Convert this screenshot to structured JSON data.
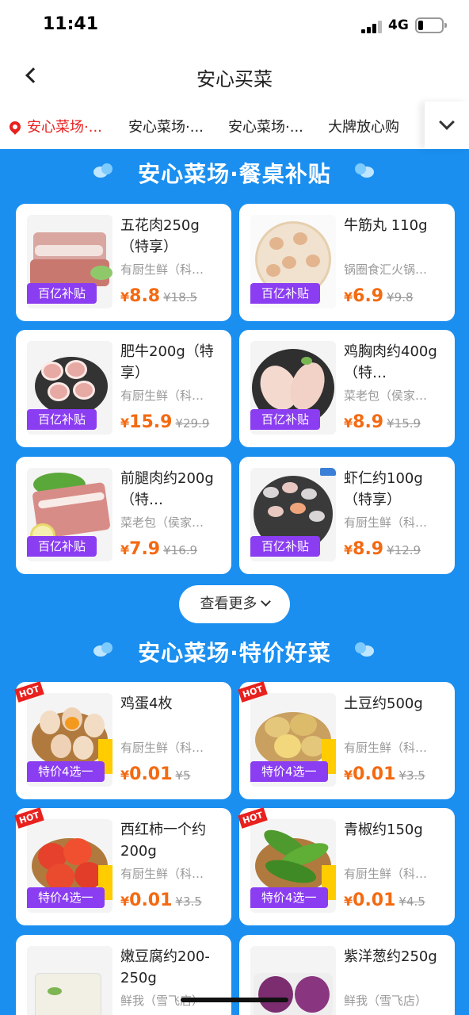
{
  "status": {
    "time": "11:41",
    "network": "4G"
  },
  "nav": {
    "title": "安心买菜"
  },
  "tabs": [
    "安心菜场·...",
    "安心菜场·...",
    "安心菜场·...",
    "大牌放心购"
  ],
  "colors": {
    "background": "#1a8ff0",
    "accent_red": "#e8211f",
    "price_orange": "#f36a12",
    "tag_purple": "#8b3df2"
  },
  "section1": {
    "title": "安心菜场·餐桌补贴",
    "items": [
      {
        "name": "五花肉250g（特享）",
        "shop": "有厨生鲜（科…",
        "tag": "百亿补贴",
        "price": "8.8",
        "currency": "¥",
        "old_price": "¥18.5",
        "image": "pork-belly"
      },
      {
        "name": "牛筋丸 110g",
        "shop": "锅圈食汇火锅…",
        "tag": "百亿补贴",
        "price": "6.9",
        "currency": "¥",
        "old_price": "¥9.8",
        "image": "beef-balls"
      },
      {
        "name": "肥牛200g（特享）",
        "shop": "有厨生鲜（科…",
        "tag": "百亿补贴",
        "price": "15.9",
        "currency": "¥",
        "old_price": "¥29.9",
        "image": "beef-slices"
      },
      {
        "name": "鸡胸肉约400g（特…",
        "shop": "菜老包（侯家…",
        "tag": "百亿补贴",
        "price": "8.9",
        "currency": "¥",
        "old_price": "¥15.9",
        "image": "chicken-breast"
      },
      {
        "name": "前腿肉约200g（特…",
        "shop": "菜老包（侯家…",
        "tag": "百亿补贴",
        "price": "7.9",
        "currency": "¥",
        "old_price": "¥16.9",
        "image": "pork-shoulder"
      },
      {
        "name": "虾仁约100g（特享）",
        "shop": "有厨生鲜（科…",
        "tag": "百亿补贴",
        "price": "8.9",
        "currency": "¥",
        "old_price": "¥12.9",
        "image": "shrimp"
      }
    ],
    "more_label": "查看更多"
  },
  "section2": {
    "title": "安心菜场·特价好菜",
    "items": [
      {
        "name": "鸡蛋4枚",
        "shop": "有厨生鲜（科…",
        "tag": "特价4选一",
        "price": "0.01",
        "currency": "¥",
        "old_price": "¥5",
        "image": "eggs"
      },
      {
        "name": "土豆约500g",
        "shop": "有厨生鲜（科…",
        "tag": "特价4选一",
        "price": "0.01",
        "currency": "¥",
        "old_price": "¥3.5",
        "image": "potatoes"
      },
      {
        "name": "西红柿一个约200g",
        "shop": "有厨生鲜（科…",
        "tag": "特价4选一",
        "price": "0.01",
        "currency": "¥",
        "old_price": "¥3.5",
        "image": "tomatoes"
      },
      {
        "name": "青椒约150g",
        "shop": "有厨生鲜（科…",
        "tag": "特价4选一",
        "price": "0.01",
        "currency": "¥",
        "old_price": "¥4.5",
        "image": "green-peppers"
      },
      {
        "name": "嫩豆腐约200-250g",
        "shop": "鲜我（雪飞店）",
        "image": "tofu"
      },
      {
        "name": "紫洋葱约250g",
        "shop": "鲜我（雪飞店）",
        "image": "red-onion"
      }
    ],
    "hot_label": "HOT"
  }
}
